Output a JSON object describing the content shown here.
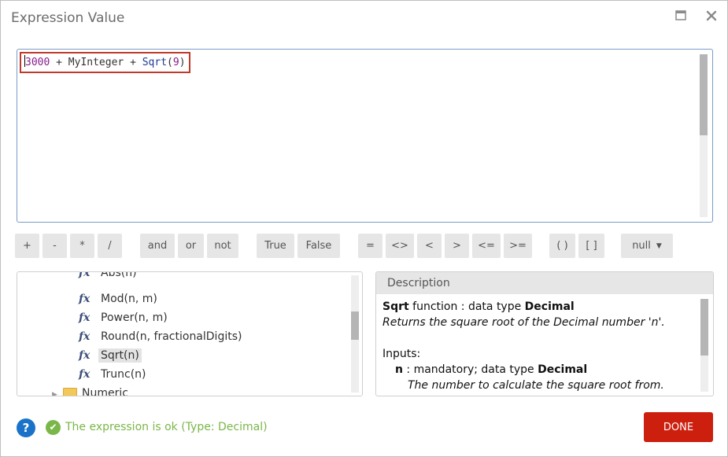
{
  "window": {
    "title": "Expression Value"
  },
  "editor": {
    "tokens": [
      {
        "text": "3000",
        "kind": "num"
      },
      {
        "text": " + ",
        "kind": "op"
      },
      {
        "text": "MyInteger",
        "kind": "id"
      },
      {
        "text": " + ",
        "kind": "op"
      },
      {
        "text": "Sqrt",
        "kind": "fn"
      },
      {
        "text": "(",
        "kind": "op"
      },
      {
        "text": "9",
        "kind": "num"
      },
      {
        "text": ")",
        "kind": "op"
      }
    ]
  },
  "toolbar": {
    "buttons": [
      {
        "label": "+",
        "name": "op-plus-button"
      },
      {
        "label": "-",
        "name": "op-minus-button"
      },
      {
        "label": "*",
        "name": "op-multiply-button"
      },
      {
        "label": "/",
        "name": "op-divide-button"
      },
      {
        "label": "and",
        "name": "op-and-button"
      },
      {
        "label": "or",
        "name": "op-or-button"
      },
      {
        "label": "not",
        "name": "op-not-button"
      },
      {
        "label": "True",
        "name": "op-true-button"
      },
      {
        "label": "False",
        "name": "op-false-button"
      },
      {
        "label": "=",
        "name": "op-equal-button"
      },
      {
        "label": "<>",
        "name": "op-not-equal-button"
      },
      {
        "label": "<",
        "name": "op-less-button"
      },
      {
        "label": ">",
        "name": "op-greater-button"
      },
      {
        "label": "<=",
        "name": "op-less-equal-button"
      },
      {
        "label": ">=",
        "name": "op-greater-equal-button"
      },
      {
        "label": "( )",
        "name": "op-parentheses-button"
      },
      {
        "label": "[ ]",
        "name": "op-brackets-button"
      }
    ],
    "null_label": "null"
  },
  "tree": {
    "items": [
      {
        "label": "Abs(n)",
        "selected": false
      },
      {
        "label": "Mod(n, m)",
        "selected": false
      },
      {
        "label": "Power(n, m)",
        "selected": false
      },
      {
        "label": "Round(n, fractionalDigits)",
        "selected": false
      },
      {
        "label": "Sqrt(n)",
        "selected": true
      },
      {
        "label": "Trunc(n)",
        "selected": false
      }
    ],
    "folder_label": "Numeric"
  },
  "description": {
    "header": "Description",
    "fn_name": "Sqrt",
    "fn_mid": " function : data type ",
    "fn_type": "Decimal",
    "summary": "Returns the square root of the Decimal number 'n'.",
    "inputs_label": "Inputs:",
    "param_name": "n",
    "param_mid": " : mandatory; data type ",
    "param_type": "Decimal",
    "param_desc": "The number to calculate the square root from."
  },
  "footer": {
    "help_glyph": "?",
    "ok_glyph": "✔",
    "status": "The expression is ok (Type: Decimal)",
    "done_label": "DONE"
  },
  "colors": {
    "accent": "#cc1f0e",
    "status_ok": "#7ab648",
    "help": "#1a73c9"
  }
}
